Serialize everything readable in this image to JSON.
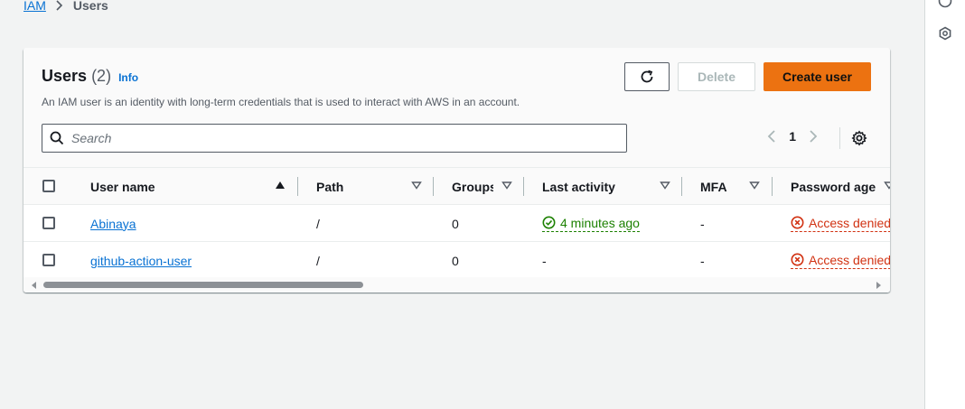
{
  "breadcrumb": {
    "root": "IAM",
    "current": "Users"
  },
  "header": {
    "title": "Users",
    "count": "(2)",
    "info": "Info",
    "description": "An IAM user is an identity with long-term credentials that is used to interact with AWS in an account."
  },
  "actions": {
    "delete": "Delete",
    "create": "Create user"
  },
  "search": {
    "placeholder": "Search"
  },
  "pagination": {
    "current_page": "1"
  },
  "table": {
    "columns": [
      "User name",
      "Path",
      "Groups",
      "Last activity",
      "MFA",
      "Password age"
    ],
    "rows": [
      {
        "user_name": "Abinaya",
        "path": "/",
        "groups": "0",
        "last_activity": "4 minutes ago",
        "mfa": "-",
        "password_age": "Access denied"
      },
      {
        "user_name": "github-action-user",
        "path": "/",
        "groups": "0",
        "last_activity": "-",
        "mfa": "-",
        "password_age": "Access denied"
      }
    ]
  },
  "colors": {
    "primary": "#ec7211",
    "link": "#0972d3",
    "success": "#1d8102",
    "error": "#d13212"
  }
}
